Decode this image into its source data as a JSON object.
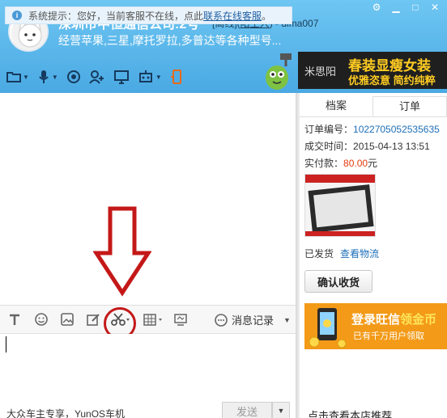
{
  "header": {
    "title": "深圳市中恒通信公司:2号",
    "status_prefix": "[离线](",
    "status_stranger": "陌生人",
    "status_suffix": ") - dima007",
    "subtitle": "经营苹果,三星,摩托罗拉,多普达等各种型号..."
  },
  "banner": {
    "brand": "米思阳",
    "line1": "春装显瘦女装",
    "line2": "优雅恣意 简约纯粹"
  },
  "chat": {
    "system_label": "系统提示：您好，当前客服不在线，点此",
    "system_link": "联系在线客服",
    "system_end": "。"
  },
  "input_toolbar": {
    "history_label": "消息记录"
  },
  "bottom": {
    "ad_text": "大众车主专享，YunOS车机",
    "send_label": "发送"
  },
  "right_panel": {
    "tabs": [
      {
        "label": "档案",
        "active": false
      },
      {
        "label": "订单",
        "active": true
      }
    ],
    "order_no_label": "订单编号：",
    "order_no": "1022705052535635",
    "time_label": "成交时间：",
    "time": "2015-04-13 13:51",
    "paid_label": "实付款：",
    "paid_amount": "80.00",
    "paid_unit": "元",
    "ship_status": "已发货",
    "logistics_link": "查看物流",
    "confirm_label": "确认收货",
    "promo_line1_a": "登录旺信",
    "promo_line1_b": "领金币",
    "promo_line2": "已有千万用户领取",
    "more_label": "点击查看本店推荐"
  },
  "colors": {
    "header": "#5bb6ea",
    "link": "#1e6fb8",
    "price": "#e53c0c",
    "annotation": "#c41818",
    "promo": "#f39a18"
  }
}
